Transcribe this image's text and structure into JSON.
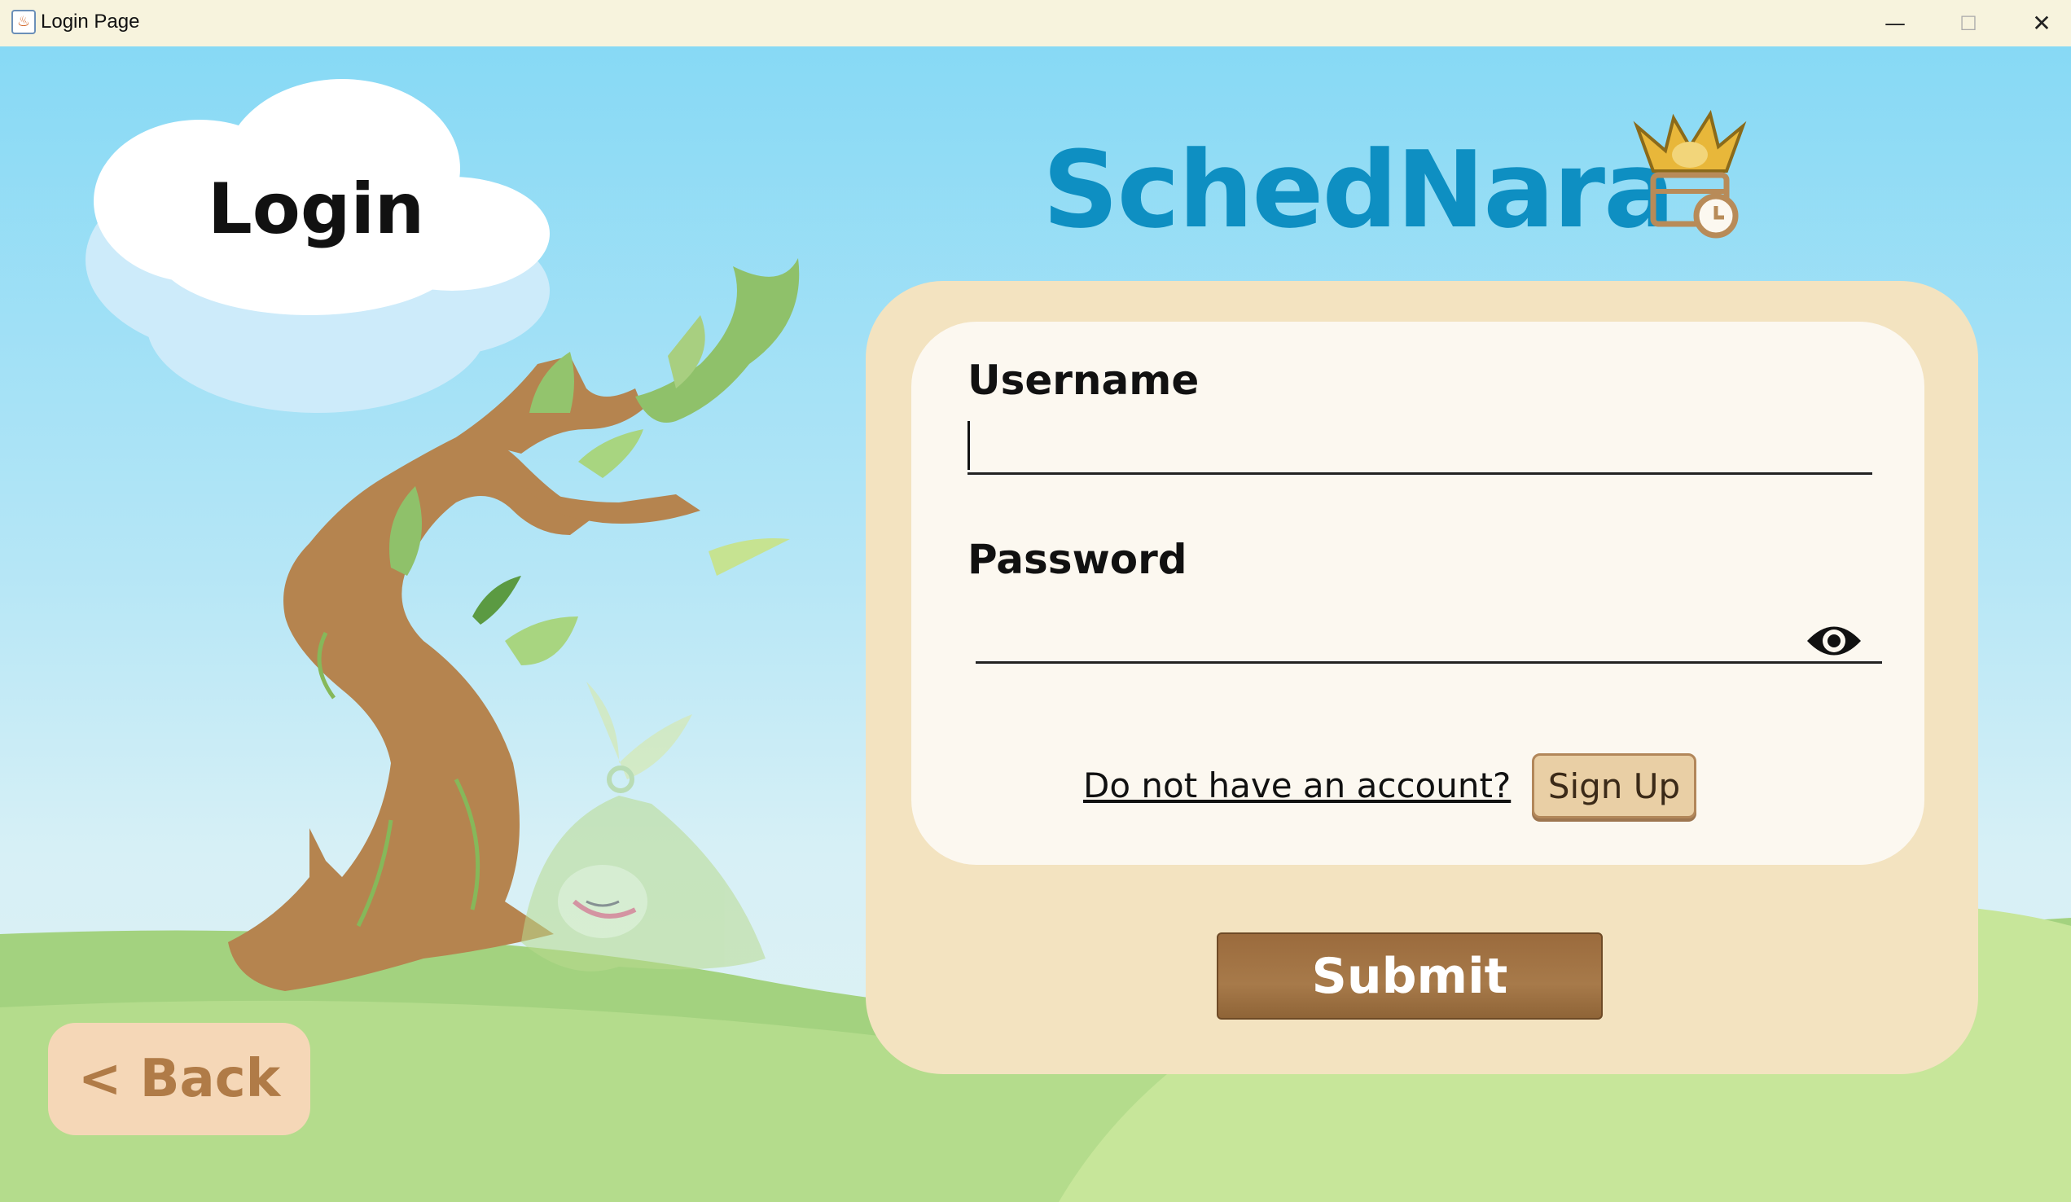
{
  "window": {
    "title": "Login Page",
    "controls": {
      "minimize": "—",
      "maximize": "☐",
      "close": "✕"
    }
  },
  "page": {
    "heading": "Login",
    "logo_text": "SchedNara"
  },
  "form": {
    "username_label": "Username",
    "username_value": "",
    "password_label": "Password",
    "password_value": "",
    "no_account_text": "Do not have an account?",
    "signup_label": "Sign Up",
    "submit_label": "Submit"
  },
  "nav": {
    "back_label": "< Back"
  },
  "icons": {
    "app": "java-icon",
    "logo": "crowned-calendar-clock-icon",
    "password_toggle": "eye-icon"
  },
  "colors": {
    "brand": "#0e8fc2",
    "panel": "#f3e3c0",
    "card": "#fcf8f0",
    "submit": "#9b6b3d",
    "back": "#f5d7b7"
  }
}
